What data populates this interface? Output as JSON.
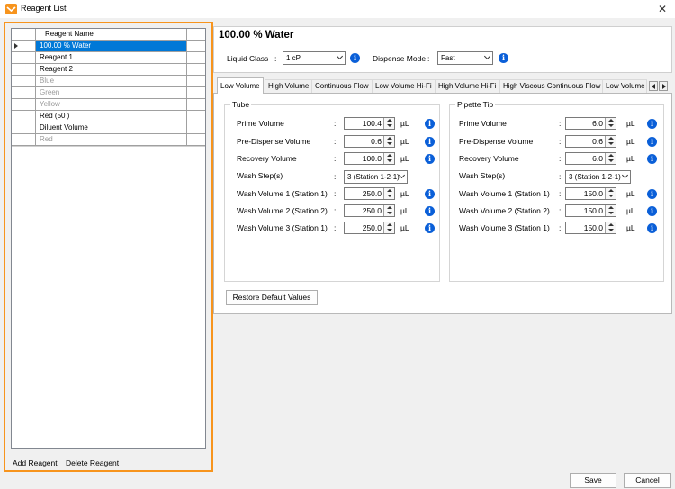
{
  "window": {
    "title": "Reagent List",
    "close_label": "✕"
  },
  "reagent_list": {
    "header": "Reagent Name",
    "rows": [
      {
        "name": "100.00 % Water",
        "state": "selected"
      },
      {
        "name": "Reagent 1",
        "state": "normal"
      },
      {
        "name": "Reagent 2",
        "state": "normal"
      },
      {
        "name": "Blue",
        "state": "disabled"
      },
      {
        "name": "Green",
        "state": "disabled"
      },
      {
        "name": "Yellow",
        "state": "disabled"
      },
      {
        "name": "Red (50 )",
        "state": "normal"
      },
      {
        "name": "Diluent Volume",
        "state": "normal"
      },
      {
        "name": "Red",
        "state": "disabled"
      }
    ],
    "add_label": "Add Reagent",
    "delete_label": "Delete Reagent"
  },
  "reagent_detail": {
    "title": "100.00 % Water",
    "liquid_class_label": "Liquid Class",
    "liquid_class_value": "1 cP",
    "dispense_mode_label": "Dispense Mode",
    "dispense_mode_value": "Fast",
    "colon": ":"
  },
  "tabs": [
    {
      "label": "Low Volume",
      "active": true
    },
    {
      "label": "High Volume",
      "active": false
    },
    {
      "label": "Continuous Flow",
      "active": false
    },
    {
      "label": "Low Volume Hi-Fi",
      "active": false
    },
    {
      "label": "High Volume Hi-Fi",
      "active": false
    },
    {
      "label": "High Viscous Continuous Flow",
      "active": false
    },
    {
      "label": "Low Volume",
      "active": false
    }
  ],
  "tube": {
    "title": "Tube",
    "prime_label": "Prime Volume",
    "prime_value": "100.4",
    "pre_dispense_label": "Pre-Dispense Volume",
    "pre_dispense_value": "0.6",
    "recovery_label": "Recovery Volume",
    "recovery_value": "100.0",
    "wash_steps_label": "Wash Step(s)",
    "wash_steps_value": "3 (Station 1-2-1)",
    "wash1_label": "Wash Volume 1 (Station 1)",
    "wash1_value": "250.0",
    "wash2_label": "Wash Volume 2 (Station 2)",
    "wash2_value": "250.0",
    "wash3_label": "Wash Volume 3 (Station 1)",
    "wash3_value": "250.0"
  },
  "pipette_tip": {
    "title": "Pipette Tip",
    "prime_label": "Prime Volume",
    "prime_value": "6.0",
    "pre_dispense_label": "Pre-Dispense Volume",
    "pre_dispense_value": "0.6",
    "recovery_label": "Recovery Volume",
    "recovery_value": "6.0",
    "wash_steps_label": "Wash Step(s)",
    "wash_steps_value": "3 (Station 1-2-1)",
    "wash1_label": "Wash Volume 1 (Station 1)",
    "wash1_value": "150.0",
    "wash2_label": "Wash Volume 2 (Station 2)",
    "wash2_value": "150.0",
    "wash3_label": "Wash Volume 3 (Station 1)",
    "wash3_value": "150.0"
  },
  "unit": "µL",
  "info_glyph": "i",
  "restore_label": "Restore Default Values",
  "save_label": "Save",
  "cancel_label": "Cancel",
  "colors": {
    "accent_border": "#f7941d",
    "selection": "#0078d7",
    "info": "#0a5fd8"
  },
  "icons": {
    "app": "reagent-logo-icon",
    "info": "info-icon",
    "spin": "spinner-icon"
  }
}
